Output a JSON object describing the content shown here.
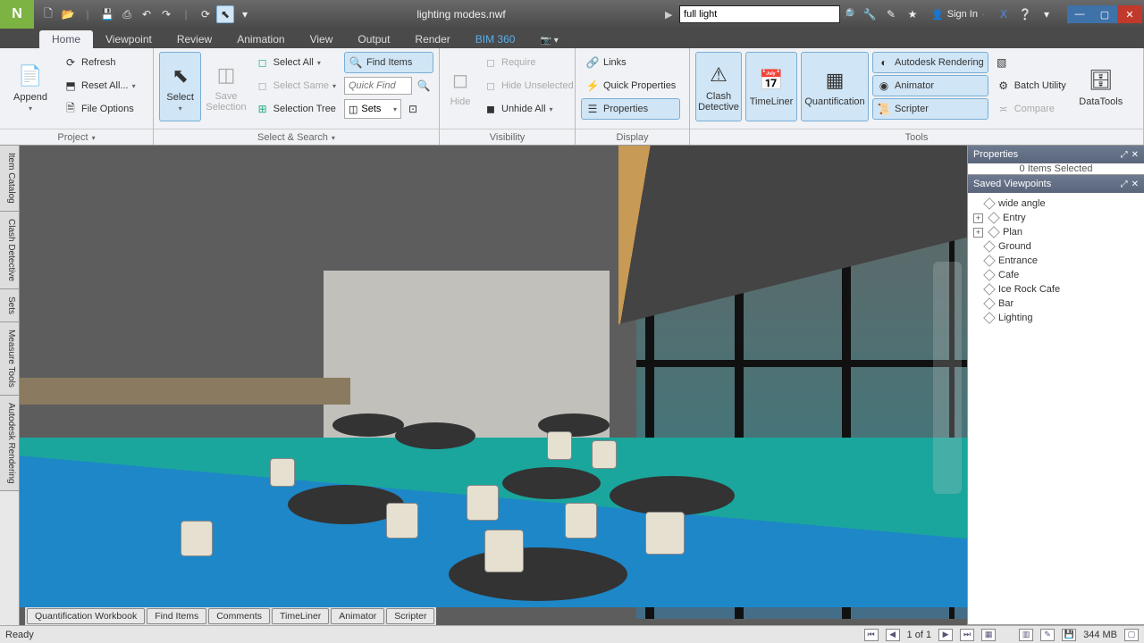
{
  "window": {
    "title": "lighting modes.nwf"
  },
  "search": {
    "value": "full light"
  },
  "auth": {
    "label": "Sign In"
  },
  "tabs": {
    "items": [
      "Home",
      "Viewpoint",
      "Review",
      "Animation",
      "View",
      "Output",
      "Render",
      "BIM 360"
    ],
    "active": 0
  },
  "ribbon": {
    "project": {
      "append": "Append",
      "refresh": "Refresh",
      "reset": "Reset All...",
      "fileoptions": "File Options",
      "title": "Project"
    },
    "selectsearch": {
      "select": "Select",
      "save_selection": "Save Selection",
      "select_all": "Select All",
      "select_same": "Select Same",
      "selection_tree": "Selection Tree",
      "find_items": "Find Items",
      "quick_find_placeholder": "Quick Find",
      "sets": "Sets",
      "title": "Select & Search"
    },
    "visibility": {
      "hide": "Hide",
      "require": "Require",
      "hide_unselected": "Hide Unselected",
      "unhide_all": "Unhide All",
      "title": "Visibility"
    },
    "display": {
      "links": "Links",
      "quick_properties": "Quick Properties",
      "properties": "Properties",
      "title": "Display"
    },
    "tools": {
      "clash": "Clash Detective",
      "timeliner": "TimeLiner",
      "quantification": "Quantification",
      "autodesk_rendering": "Autodesk Rendering",
      "animator": "Animator",
      "scripter": "Scripter",
      "batch_utility": "Batch Utility",
      "compare": "Compare",
      "datatools": "DataTools",
      "title": "Tools"
    }
  },
  "side_tabs": [
    "Item Catalog",
    "Clash Detective",
    "Sets",
    "Measure Tools",
    "Autodesk Rendering"
  ],
  "properties": {
    "title": "Properties",
    "empty": "0 Items Selected"
  },
  "saved_viewpoints": {
    "title": "Saved Viewpoints",
    "items": [
      {
        "label": "wide angle",
        "expandable": false
      },
      {
        "label": "Entry",
        "expandable": true
      },
      {
        "label": "Plan",
        "expandable": true
      },
      {
        "label": "Ground",
        "expandable": false
      },
      {
        "label": "Entrance",
        "expandable": false
      },
      {
        "label": "Cafe",
        "expandable": false
      },
      {
        "label": "Ice Rock Cafe",
        "expandable": false
      },
      {
        "label": "Bar",
        "expandable": false
      },
      {
        "label": "Lighting",
        "expandable": false
      }
    ]
  },
  "doctabs": [
    "Quantification Workbook",
    "Find Items",
    "Comments",
    "TimeLiner",
    "Animator",
    "Scripter"
  ],
  "status": {
    "ready": "Ready",
    "page": "1 of 1",
    "mem": "344 MB"
  }
}
